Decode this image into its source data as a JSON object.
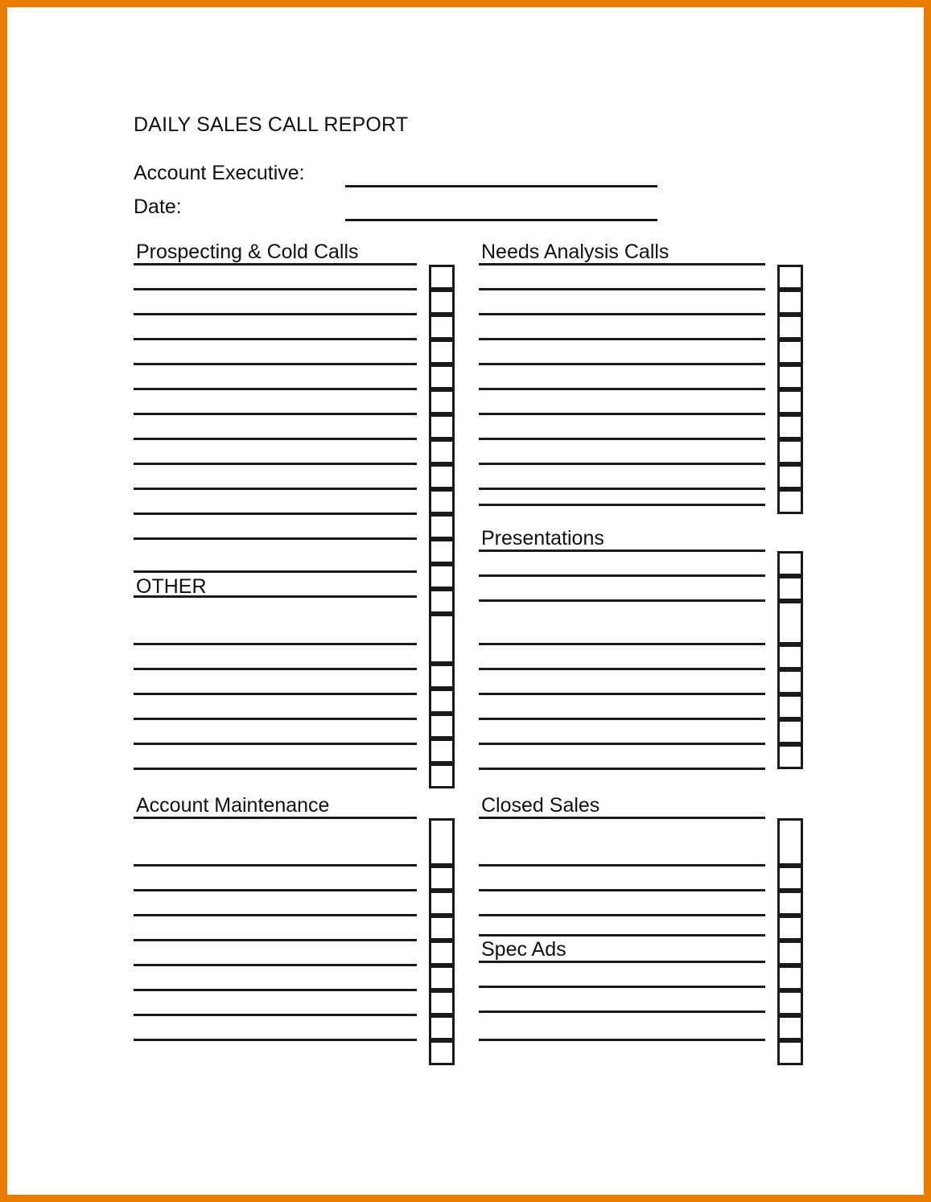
{
  "page": {
    "border_color": "#e87b00",
    "background_color": "#ffffff",
    "ink_color": "#1a1a1a"
  },
  "header": {
    "title": "DAILY SALES CALL REPORT",
    "fields": [
      {
        "label": "Account Executive:",
        "value": ""
      },
      {
        "label": "Date:",
        "value": ""
      }
    ]
  },
  "sections": {
    "prospecting": {
      "label": "Prospecting & Cold Calls"
    },
    "other": {
      "label": "OTHER"
    },
    "account_maintenance": {
      "label": "Account Maintenance"
    },
    "needs_analysis": {
      "label": "Needs Analysis Calls"
    },
    "presentations": {
      "label": "Presentations"
    },
    "closed_sales": {
      "label": "Closed Sales"
    },
    "spec_ads": {
      "label": "Spec Ads"
    }
  }
}
